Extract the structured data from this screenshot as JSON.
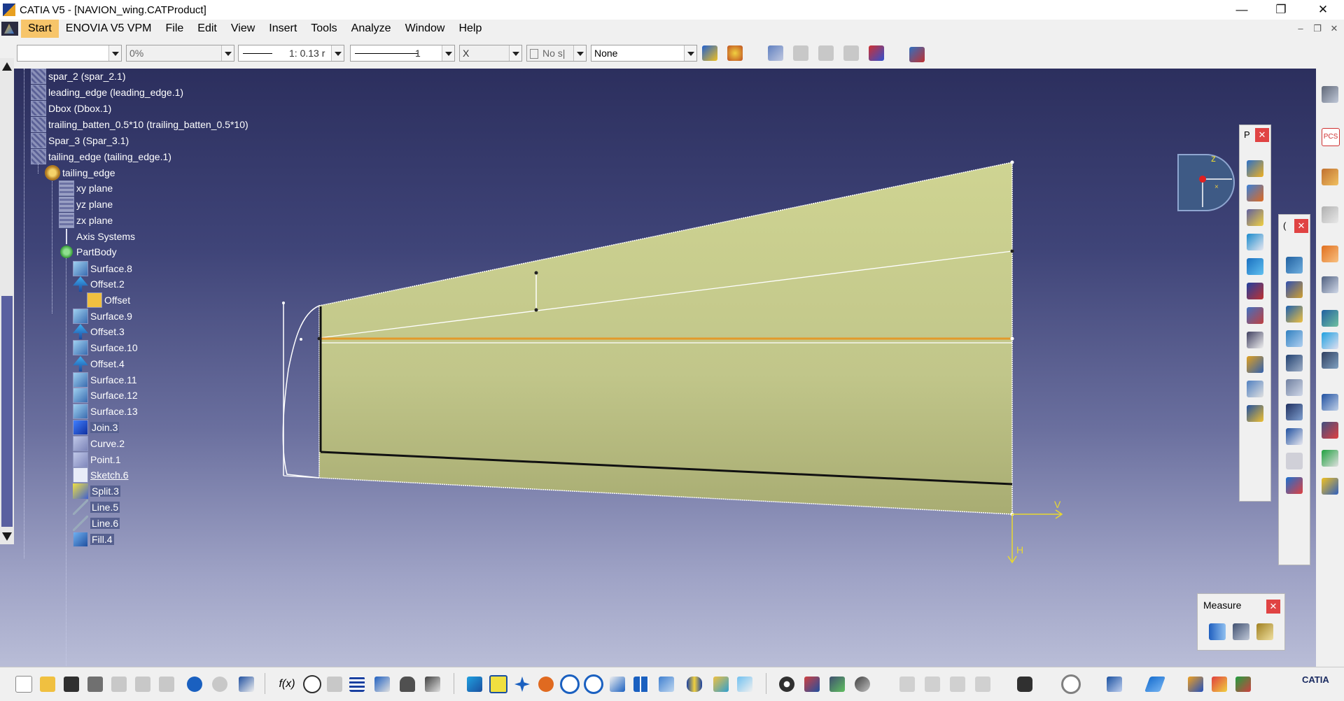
{
  "window": {
    "title": "CATIA V5 - [NAVION_wing.CATProduct]",
    "controls": [
      "minimize-icon",
      "restore-icon",
      "close-icon"
    ]
  },
  "menu": {
    "items": [
      "Start",
      "ENOVIA V5 VPM",
      "File",
      "Edit",
      "View",
      "Insert",
      "Tools",
      "Analyze",
      "Window",
      "Help"
    ],
    "active": "Start"
  },
  "properties_toolbar": {
    "color_value": "",
    "transparency_value": "0%",
    "line_thickness_value": "1: 0.13 r",
    "line_type_value": "1",
    "point_type_value": "X",
    "layer_value": "No s|",
    "layer_prefix_icon": "layer-icon",
    "rendering_style_value": "None"
  },
  "tree": {
    "items": [
      {
        "label": "spar_2 (spar_2.1)",
        "icon": "product-icon"
      },
      {
        "label": "leading_edge (leading_edge.1)",
        "icon": "product-icon"
      },
      {
        "label": "Dbox (Dbox.1)",
        "icon": "product-icon"
      },
      {
        "label": "trailing_batten_0.5*10 (trailing_batten_0.5*10)",
        "icon": "product-icon"
      },
      {
        "label": "Spar_3 (Spar_3.1)",
        "icon": "product-icon"
      },
      {
        "label": "tailing_edge (tailing_edge.1)",
        "icon": "product-icon"
      },
      {
        "label": "tailing_edge",
        "icon": "part-icon"
      },
      {
        "label": "xy plane",
        "icon": "plane-icon"
      },
      {
        "label": "yz plane",
        "icon": "plane-icon"
      },
      {
        "label": "zx plane",
        "icon": "plane-icon"
      },
      {
        "label": "Axis Systems",
        "icon": "axis-systems-icon"
      },
      {
        "label": "PartBody",
        "icon": "partbody-icon"
      },
      {
        "label": "Surface.8",
        "icon": "surface-icon"
      },
      {
        "label": "Offset.2",
        "icon": "offset-icon"
      },
      {
        "label": "Offset",
        "icon": "offset-feature-icon"
      },
      {
        "label": "Surface.9",
        "icon": "surface-icon"
      },
      {
        "label": "Offset.3",
        "icon": "offset-icon"
      },
      {
        "label": "Surface.10",
        "icon": "surface-icon"
      },
      {
        "label": "Offset.4",
        "icon": "offset-icon"
      },
      {
        "label": "Surface.11",
        "icon": "surface-icon"
      },
      {
        "label": "Surface.12",
        "icon": "surface-icon"
      },
      {
        "label": "Surface.13",
        "icon": "surface-icon"
      },
      {
        "label": "Join.3",
        "icon": "join-icon"
      },
      {
        "label": "Curve.2",
        "icon": "curve-icon"
      },
      {
        "label": "Point.1",
        "icon": "point-icon"
      },
      {
        "label": "Sketch.6",
        "icon": "sketch-icon"
      },
      {
        "label": "Split.3",
        "icon": "split-icon"
      },
      {
        "label": "Line.5",
        "icon": "line-icon"
      },
      {
        "label": "Line.6",
        "icon": "line-icon"
      },
      {
        "label": "Fill.4",
        "icon": "fill-icon"
      }
    ]
  },
  "compass": {
    "axis_label": "z"
  },
  "axes": {
    "v_label": "V",
    "h_label": "H"
  },
  "palettes": {
    "palette1_title": "P",
    "palette2_title": "(",
    "measure_title": "Measure"
  },
  "colors": {
    "surface_fill": "#c9cf8c",
    "selection_edge": "#e39a2b",
    "viewport_top": "#2c2f5e",
    "viewport_bottom": "#b9bdd7",
    "active_menu": "#f7c56a",
    "close_button": "#e04343",
    "axis_color": "#e8d830"
  },
  "branding": {
    "logo_text": "CATIA"
  }
}
